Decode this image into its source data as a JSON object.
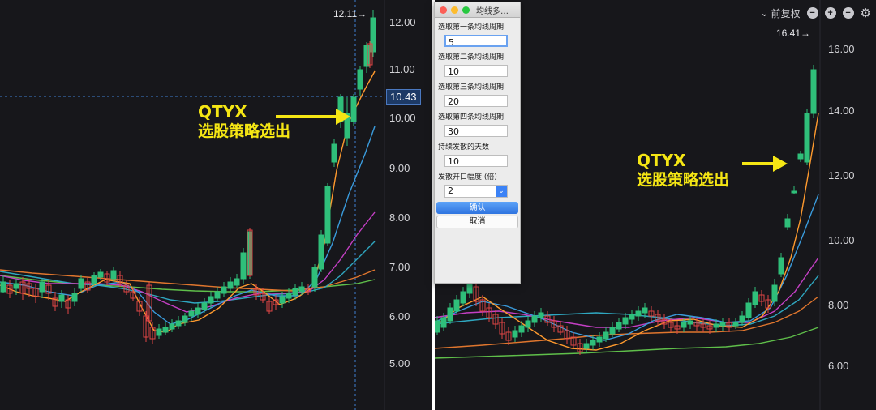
{
  "left_chart": {
    "price_axis": [
      "12.00",
      "11.00",
      "10.00",
      "9.00",
      "8.00",
      "7.00",
      "6.00",
      "5.00"
    ],
    "peak_label": "12.11→",
    "crosshair_price": "10.43",
    "annotation": {
      "line1": "QTYX",
      "line2": "选股策略选出"
    }
  },
  "right_chart": {
    "price_axis": [
      "16.00",
      "14.00",
      "12.00",
      "10.00",
      "8.00",
      "6.00"
    ],
    "peak_label": "16.41→",
    "annotation": {
      "line1": "QTYX",
      "line2": "选股策略选出"
    },
    "toolbar": {
      "fuquan_label": "前复权",
      "chevron": "chevron-down-icon",
      "minus1": "minus-circle-icon",
      "plus": "plus-circle-icon",
      "minus2": "minus-circle-icon",
      "gear": "gear-icon"
    }
  },
  "dialog": {
    "title": "均线多…",
    "fields": [
      {
        "label": "选取第一条均线周期",
        "value": "5"
      },
      {
        "label": "选取第二条均线周期",
        "value": "10"
      },
      {
        "label": "选取第三条均线周期",
        "value": "20"
      },
      {
        "label": "选取第四条均线周期",
        "value": "30"
      },
      {
        "label": "持续发散的天数",
        "value": "10"
      }
    ],
    "select_label": "发散开口幅度 (倍)",
    "select_value": "2",
    "confirm_label": "确认",
    "cancel_label": "取消"
  },
  "colors": {
    "background": "#17171b",
    "up_candle": "#e04646",
    "down_candle": "#2fbf7a",
    "annotation": "#f5e614",
    "ma5": "#ff9a2e",
    "ma10": "#3a9bdc",
    "ma20": "#c43fc4",
    "ma30": "#2fa7c0",
    "ma60": "#e0762e",
    "ma120": "#5fbf4a"
  }
}
